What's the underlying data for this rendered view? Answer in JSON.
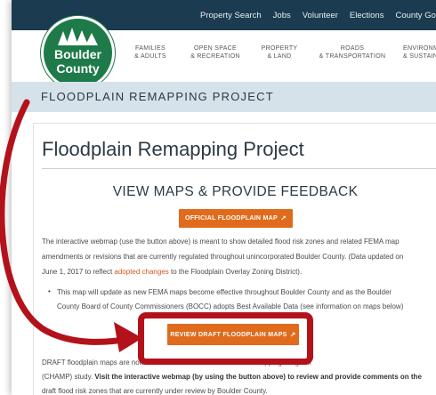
{
  "topbar": {
    "links": [
      "Property Search",
      "Jobs",
      "Volunteer",
      "Elections",
      "County Government"
    ]
  },
  "logo": {
    "line1": "Boulder",
    "line2": "County"
  },
  "nav": [
    {
      "line1": "FAMILIES",
      "line2": "& ADULTS"
    },
    {
      "line1": "OPEN SPACE",
      "line2": "& RECREATION"
    },
    {
      "line1": "PROPERTY",
      "line2": "& LAND"
    },
    {
      "line1": "ROADS",
      "line2": "& TRANSPORTATION"
    },
    {
      "line1": "ENVIRONMENT",
      "line2": "& SUSTAINABILITY"
    }
  ],
  "breadcrumb": "FLOODPLAIN REMAPPING PROJECT",
  "page_title": "Floodplain Remapping Project",
  "section_title": "VIEW MAPS & PROVIDE FEEDBACK",
  "buttons": {
    "official_map": "OFFICIAL FLOODPLAIN MAP",
    "review_draft": "REVIEW DRAFT FLOODPLAIN MAPS",
    "ext_icon": "↗"
  },
  "intro": {
    "line1": "The interactive webmap (use the button above) is meant to show detailed flood risk zones and related FEMA map",
    "line2": "amendments or revisions that are currently regulated throughout unincorporated Boulder County. (Data updated on",
    "line3a": "June 1, 2017 to reflect ",
    "line3_link": "adopted changes",
    "line3b": " to the Floodplain Overlay Zoning District)."
  },
  "bullet": {
    "line1": "This map will update as new FEMA maps become effective throughout Boulder County and as the Boulder",
    "line2": "County Board of County Commissioners (BOCC) adopts Best Available Data (see information on maps below)"
  },
  "draft": {
    "line1a": "DRAFT floodplain maps are now available for the Colorado Hazard Mapping Program",
    "line2a": "(CHAMP) study. ",
    "line2_bold": "Visit the interactive webmap (by using the button above) to review and provide comments on the",
    "line3": "draft flood risk zones that are currently under review by Boulder County."
  },
  "colors": {
    "topbar": "#1b3b50",
    "brand_green": "#1f7a4a",
    "accent_orange": "#e06b1c",
    "highlight_red": "#b3121b",
    "band": "#d6e2ea"
  }
}
